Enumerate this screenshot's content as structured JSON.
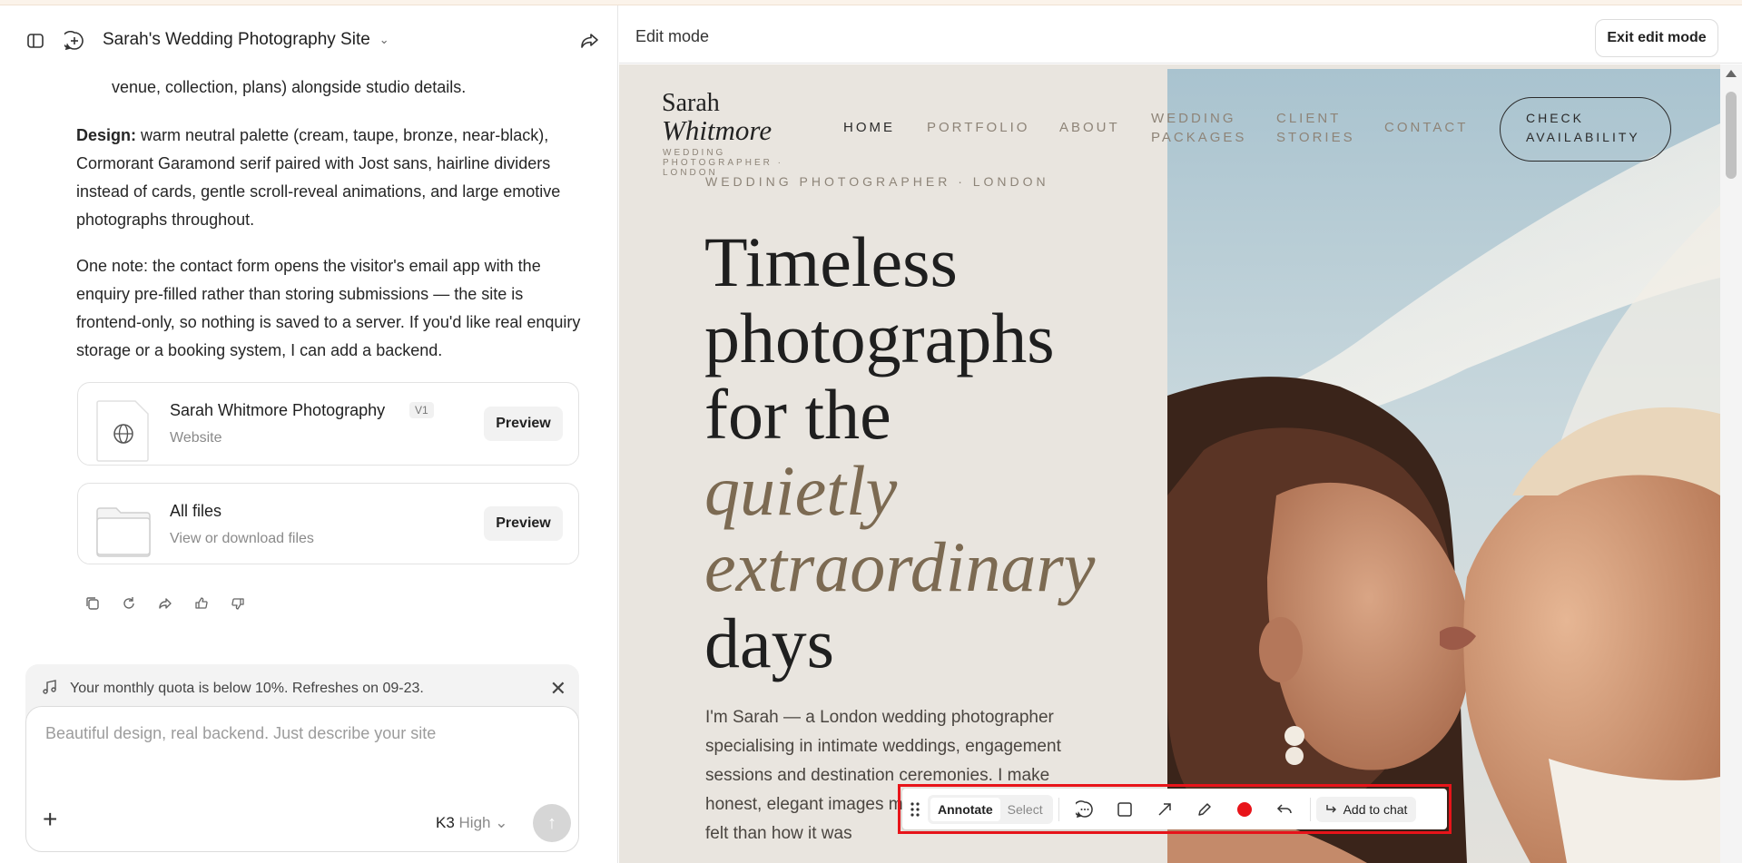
{
  "chat": {
    "site_title": "Sarah's Wedding Photography Site",
    "fragment_line": "venue, collection, plans) alongside studio details.",
    "design_label": "Design:",
    "design_text": " warm neutral palette (cream, taupe, bronze, near-black), Cormorant Garamond serif paired with Jost sans, hairline dividers instead of cards, gentle scroll-reveal animations, and large emotive photographs throughout.",
    "note_text": "One note: the contact form opens the visitor's email app with the enquiry pre-filled rather than storing submissions — the site is frontend-only, so nothing is saved to a server. If you'd like real enquiry storage or a booking system, I can add a backend.",
    "cards": [
      {
        "title": "Sarah Whitmore Photography",
        "version": "V1",
        "subtitle": "Website",
        "button": "Preview"
      },
      {
        "title": "All files",
        "subtitle": "View or download files",
        "button": "Preview"
      }
    ],
    "quota_text": "Your monthly quota is below 10%. Refreshes on 09-23.",
    "composer_placeholder": "Beautiful design, real backend. Just describe your site",
    "model_name": "K3",
    "model_level": "High"
  },
  "edit": {
    "mode_label": "Edit mode",
    "exit_button": "Exit edit mode"
  },
  "site": {
    "logo_first": "Sarah",
    "logo_last": "Whitmore",
    "logo_tag": "WEDDING PHOTOGRAPHER · LONDON",
    "nav": [
      {
        "label": "HOME"
      },
      {
        "label": "PORTFOLIO"
      },
      {
        "label": "ABOUT"
      },
      {
        "label": "WEDDING PACKAGES"
      },
      {
        "label": "CLIENT STORIES"
      },
      {
        "label": "CONTACT"
      }
    ],
    "cta": "CHECK AVAILABILITY",
    "eyebrow": "WEDDING PHOTOGRAPHER · LONDON",
    "hero": {
      "line1": "Timeless",
      "line2": "photographs",
      "line3": "for the",
      "line4": "quietly",
      "line5": "extraordinary",
      "line6": "days"
    },
    "intro": "I'm Sarah — a London wedding photographer specialising in intimate weddings, engagement sessions and destination ceremonies. I make honest, elegant images more about how the day felt than how it was"
  },
  "toolbar": {
    "annotate": "Annotate",
    "select": "Select",
    "add_to_chat": "Add to chat",
    "record_color": "#e8141a"
  }
}
